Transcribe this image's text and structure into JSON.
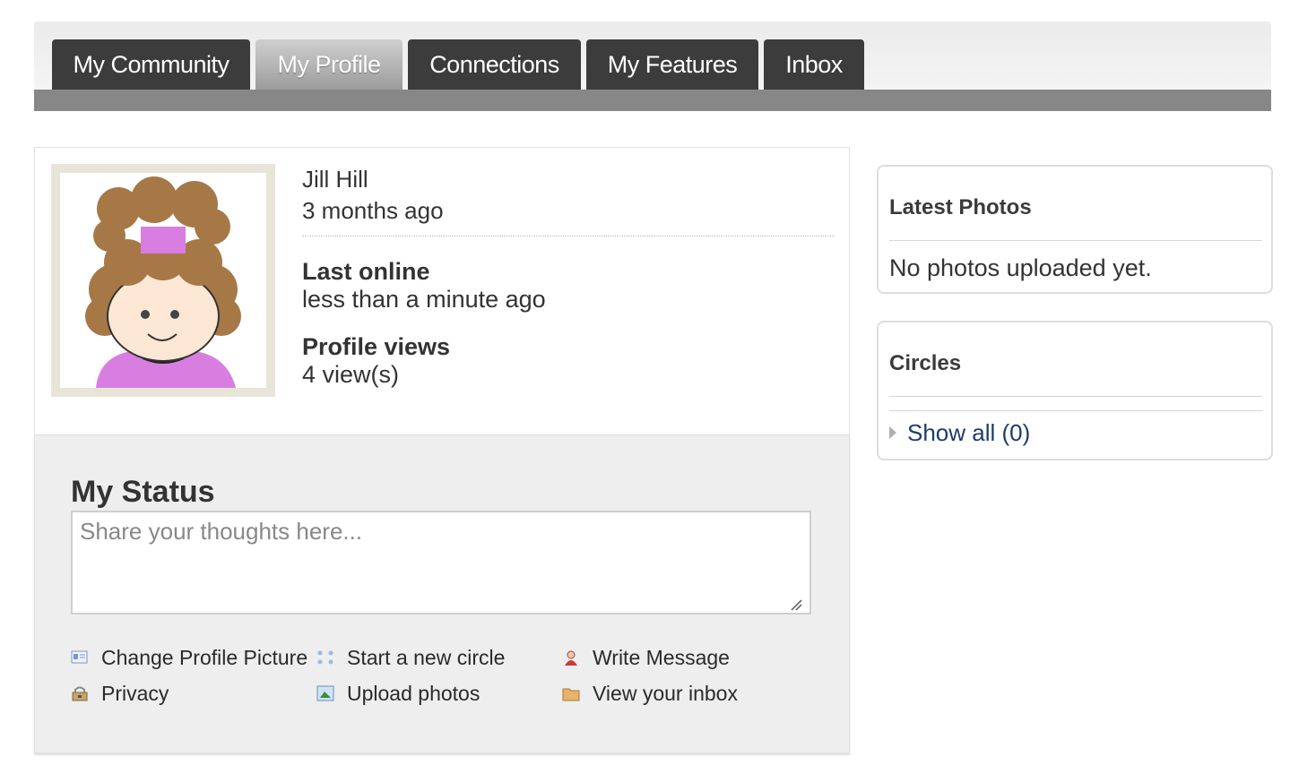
{
  "nav": {
    "tabs": [
      {
        "label": "My Community"
      },
      {
        "label": "My Profile",
        "active": true
      },
      {
        "label": "Connections"
      },
      {
        "label": "My Features"
      },
      {
        "label": "Inbox"
      }
    ]
  },
  "profile": {
    "name": "Jill Hill",
    "joined": "3 months ago",
    "last_online_label": "Last online",
    "last_online_value": "less than a minute ago",
    "views_label": "Profile views",
    "views_value": "4 view(s)"
  },
  "status": {
    "title": "My Status",
    "placeholder": "Share your thoughts here..."
  },
  "actions": {
    "change_picture": "Change Profile Picture",
    "privacy": "Privacy",
    "new_circle": "Start a new circle",
    "upload_photos": "Upload photos",
    "write_message": "Write Message",
    "view_inbox": "View your inbox"
  },
  "photos": {
    "title": "Latest Photos",
    "empty": "No photos uploaded yet."
  },
  "circles": {
    "title": "Circles",
    "show_all": "Show all (0)"
  },
  "colors": {
    "tab_bg": "#3c3c3c",
    "tab_active": "#9c9c9c",
    "nav_bar": "#878787",
    "link": "#1e3c6b",
    "panel_bg": "#eeeeee"
  },
  "icons": [
    "profile-card-icon",
    "privacy-icon",
    "circle-icon",
    "photo-icon",
    "write-message-icon",
    "inbox-folder-icon",
    "triangle-right-icon"
  ]
}
